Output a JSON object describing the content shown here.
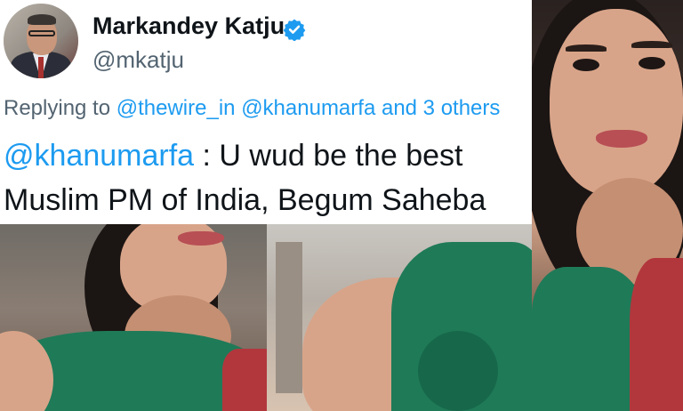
{
  "author": {
    "name": "Markandey Katju",
    "handle": "@mkatju",
    "verified_icon": "verified-badge-icon",
    "avatar_icon": "profile-photo"
  },
  "reply": {
    "prefix": "Replying to",
    "mention_1": "@thewire_in",
    "mention_2": "@khanumarfa",
    "suffix": "and 3 others"
  },
  "tweet": {
    "mention": "@khanumarfa",
    "line_1_rest": " : U wud be the best",
    "line_2": "Muslim PM of India, Begum Saheba"
  },
  "colors": {
    "link": "#1d9bf0",
    "text": "#0f1419",
    "secondary": "#536471",
    "verified": "#1d9bf0"
  }
}
